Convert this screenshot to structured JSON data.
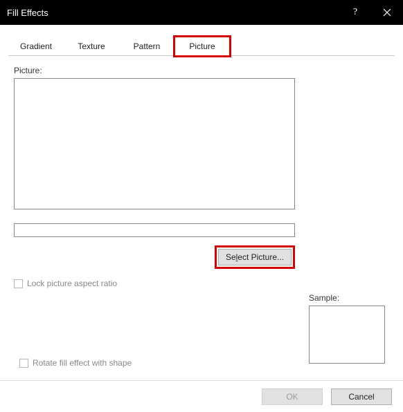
{
  "title": "Fill Effects",
  "tabs": {
    "gradient": "Gradient",
    "texture": "Texture",
    "pattern": "Pattern",
    "picture": "Picture",
    "active": "picture",
    "highlighted": "picture"
  },
  "picture": {
    "label": "Picture:",
    "select_button": "Select Picture...",
    "lock_aspect": "Lock picture aspect ratio",
    "path_value": ""
  },
  "sample": {
    "label": "Sample:"
  },
  "rotate": {
    "label": "Rotate fill effect with shape"
  },
  "footer": {
    "ok": "OK",
    "cancel": "Cancel"
  },
  "colors": {
    "highlight": "#d60000"
  }
}
